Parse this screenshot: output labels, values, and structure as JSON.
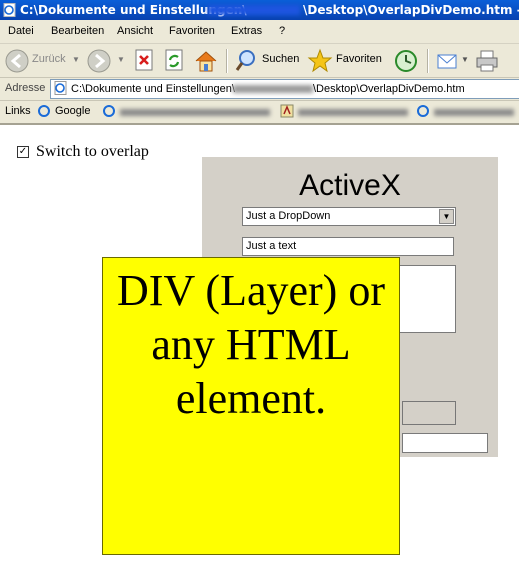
{
  "window": {
    "title_prefix": "C:\\Dokumente und Einstellungen\\",
    "title_suffix": "\\Desktop\\OverlapDivDemo.htm - Micro"
  },
  "menu": [
    "Datei",
    "Bearbeiten",
    "Ansicht",
    "Favoriten",
    "Extras",
    "?"
  ],
  "toolbar": {
    "back_label": "Zurück",
    "search_label": "Suchen",
    "favorites_label": "Favoriten"
  },
  "address": {
    "label": "Adresse",
    "path_start": "C:\\Dokumente und Einstellungen\\",
    "path_end": "\\Desktop\\OverlapDivDemo.htm"
  },
  "links": {
    "label": "Links",
    "google": "Google"
  },
  "page": {
    "checkbox_checked": true,
    "checkbox_mark": "☑",
    "checkbox_label": "Switch to overlap",
    "activex_title": "ActiveX",
    "dropdown_value": "Just a DropDown",
    "text_value": "Just a text",
    "overlay_text": "DIV (Layer) or any HTML element."
  },
  "colors": {
    "titlebar": "#0a5fd8",
    "chrome": "#ece9d8",
    "activex_bg": "#d4d0c8",
    "overlay_bg": "#ffff00"
  }
}
